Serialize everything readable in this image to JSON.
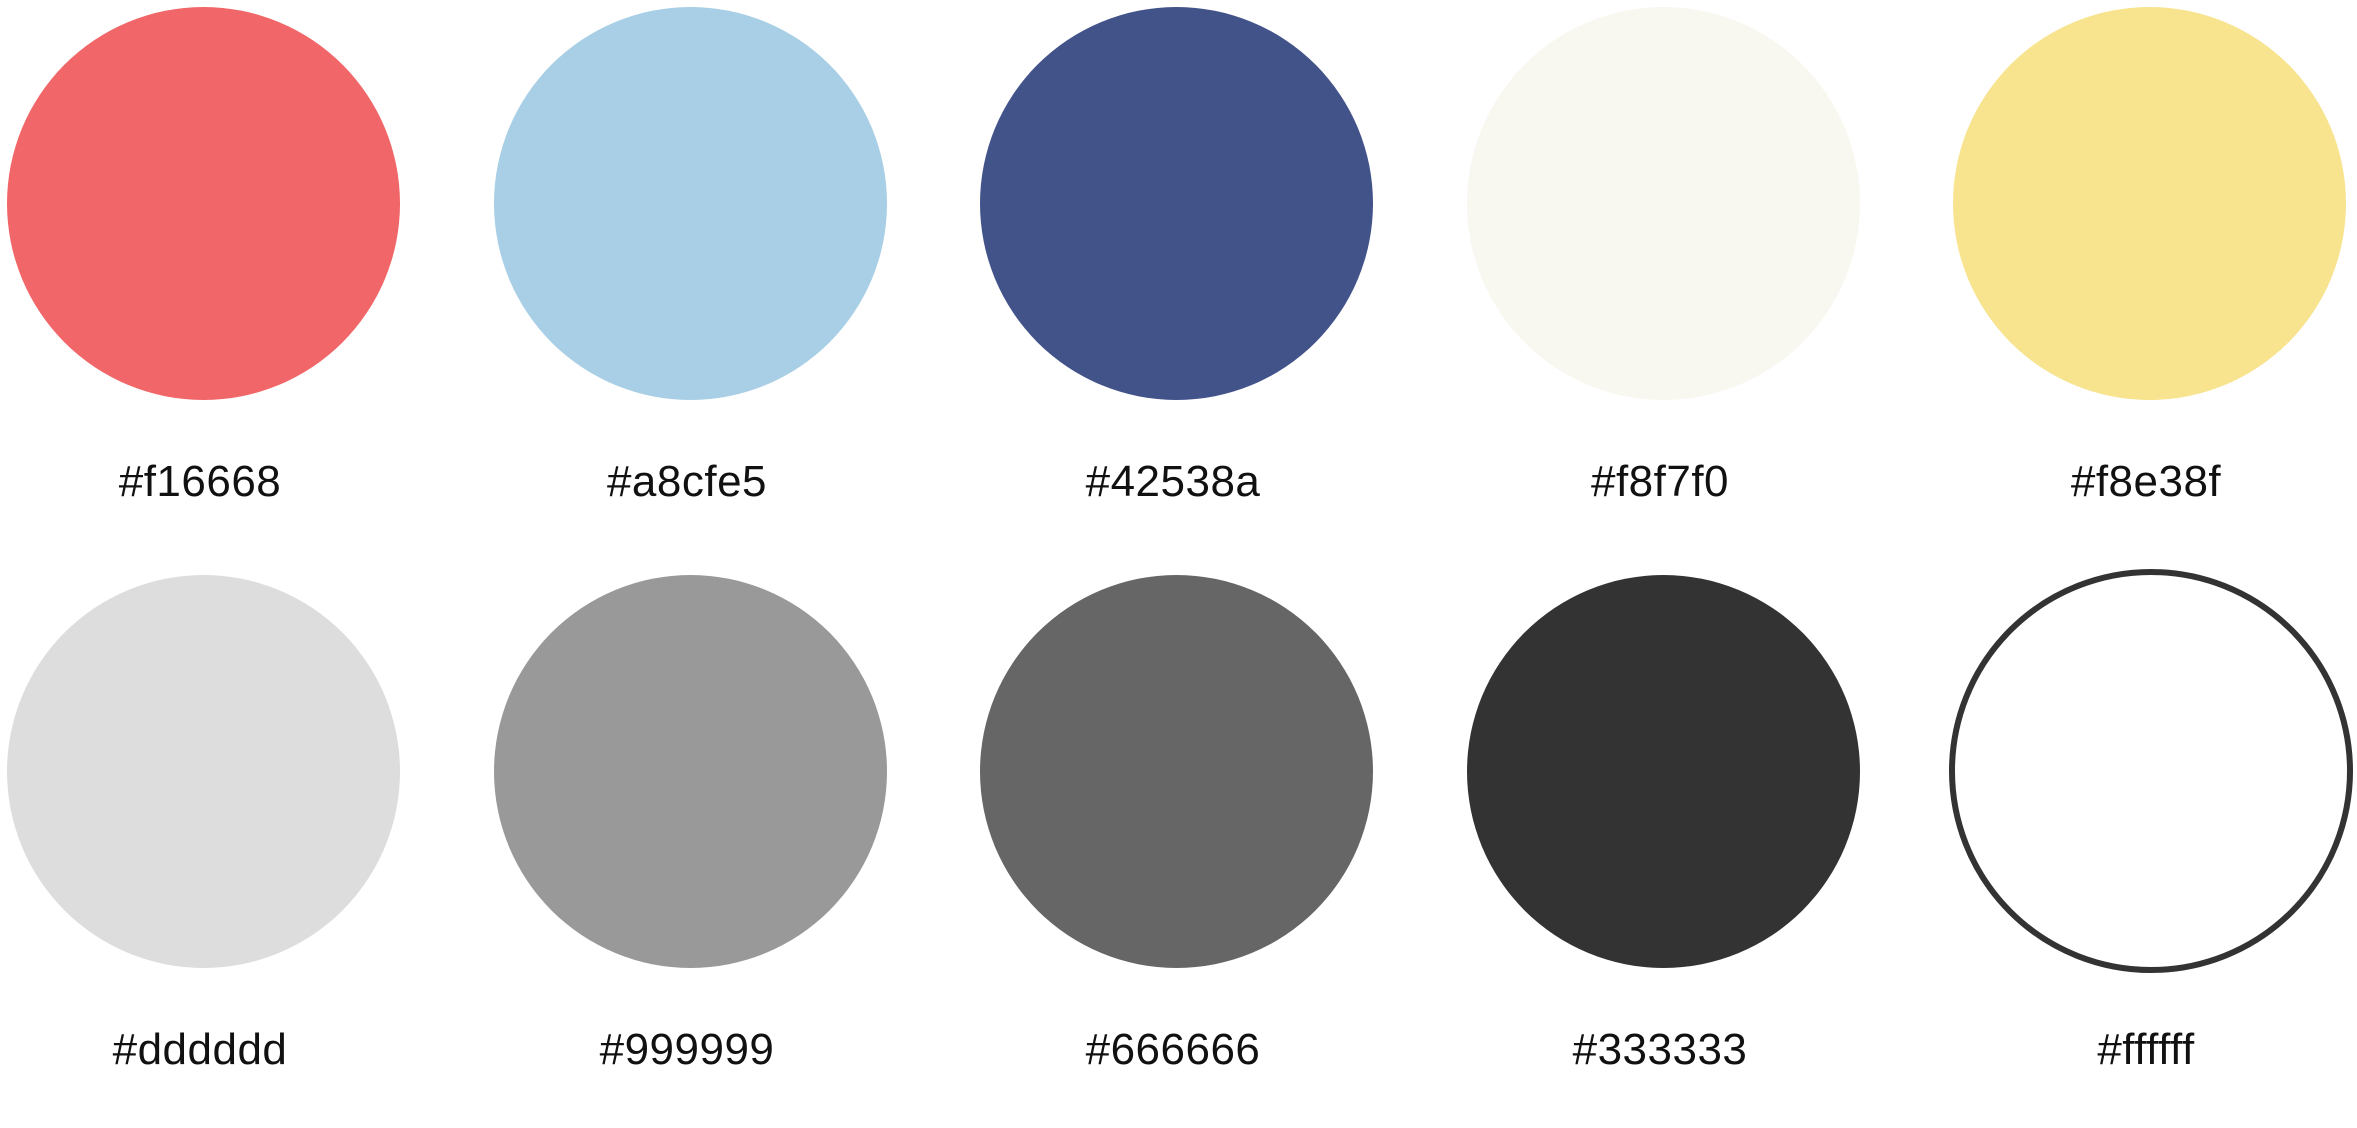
{
  "swatches": [
    {
      "color": "#f16668",
      "label": "#f16668"
    },
    {
      "color": "#a8cfe5",
      "label": "#a8cfe5"
    },
    {
      "color": "#42538a",
      "label": "#42538a"
    },
    {
      "color": "#f8f7f0",
      "label": "#f8f7f0"
    },
    {
      "color": "#f8e38f",
      "label": "#f8e38f"
    },
    {
      "color": "#dddddd",
      "label": "#dddddd"
    },
    {
      "color": "#999999",
      "label": "#999999"
    },
    {
      "color": "#666666",
      "label": "#666666"
    },
    {
      "color": "#333333",
      "label": "#333333"
    },
    {
      "color": "#ffffff",
      "label": "#ffffff",
      "outline": "#333333"
    }
  ]
}
